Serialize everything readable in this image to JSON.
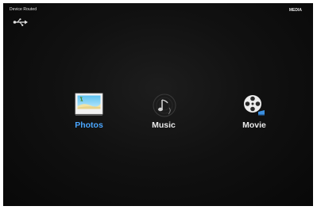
{
  "header": {
    "device_status": "Device Routed",
    "media_label": "MEDIA"
  },
  "icons": {
    "usb": "usb-icon",
    "photos": "photo-icon",
    "music": "music-disc-icon",
    "movie": "film-reel-icon"
  },
  "menu": {
    "selected_index": 0,
    "items": [
      {
        "label": "Photos"
      },
      {
        "label": "Music"
      },
      {
        "label": "Movie"
      }
    ]
  },
  "colors": {
    "background": "#111111",
    "selected_label": "#4aa6ff",
    "label": "#e9e9e9"
  }
}
